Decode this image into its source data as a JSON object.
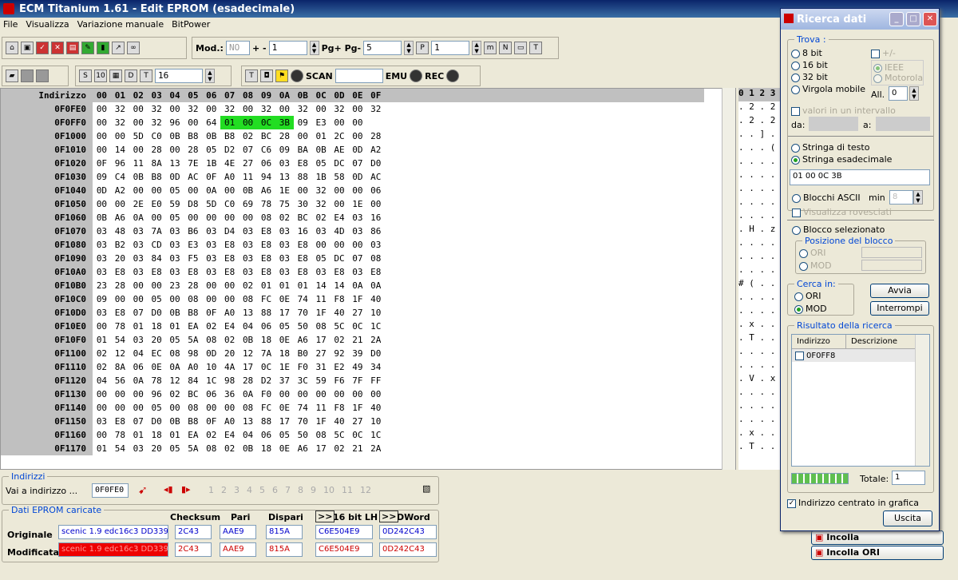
{
  "window": {
    "title": "ECM Titanium 1.61 - Edit EPROM (esadecimale)"
  },
  "menu": [
    "File",
    "Visualizza",
    "Variazione manuale",
    "BitPower"
  ],
  "toolbar": {
    "mod_label": "Mod.:",
    "mod_value": "NO",
    "plus_minus": "+ -",
    "step_value": "1",
    "pg_label": "Pg+ Pg-",
    "pg_value": "5",
    "p_value": "1",
    "width_value": "16",
    "scan_label": "SCAN",
    "emu_label": "EMU",
    "rec_label": "REC"
  },
  "hex": {
    "header_addr": "Indirizzo",
    "columns": [
      "00",
      "01",
      "02",
      "03",
      "04",
      "05",
      "06",
      "07",
      "08",
      "09",
      "0A",
      "0B",
      "0C",
      "0D",
      "0E",
      "0F"
    ],
    "rows": [
      {
        "addr": "0F0FE0",
        "bytes": [
          "00",
          "32",
          "00",
          "32",
          "00",
          "32",
          "00",
          "32",
          "00",
          "32",
          "00",
          "32",
          "00",
          "32",
          "00",
          "32"
        ]
      },
      {
        "addr": "0F0FF0",
        "bytes": [
          "00",
          "32",
          "00",
          "32",
          "96",
          "00",
          "64",
          "01",
          "00",
          "0C",
          "3B",
          "09",
          "E3",
          "00",
          "00"
        ]
      },
      {
        "addr": "0F1000",
        "bytes": [
          "00",
          "00",
          "5D",
          "C0",
          "0B",
          "B8",
          "0B",
          "B8",
          "02",
          "BC",
          "28",
          "00",
          "01",
          "2C",
          "00",
          "28"
        ]
      },
      {
        "addr": "0F1010",
        "bytes": [
          "00",
          "14",
          "00",
          "28",
          "00",
          "28",
          "05",
          "D2",
          "07",
          "C6",
          "09",
          "BA",
          "0B",
          "AE",
          "0D",
          "A2"
        ]
      },
      {
        "addr": "0F1020",
        "bytes": [
          "0F",
          "96",
          "11",
          "8A",
          "13",
          "7E",
          "1B",
          "4E",
          "27",
          "06",
          "03",
          "E8",
          "05",
          "DC",
          "07",
          "D0"
        ]
      },
      {
        "addr": "0F1030",
        "bytes": [
          "09",
          "C4",
          "0B",
          "B8",
          "0D",
          "AC",
          "0F",
          "A0",
          "11",
          "94",
          "13",
          "88",
          "1B",
          "58",
          "0D",
          "AC"
        ]
      },
      {
        "addr": "0F1040",
        "bytes": [
          "0D",
          "A2",
          "00",
          "00",
          "05",
          "00",
          "0A",
          "00",
          "0B",
          "A6",
          "1E",
          "00",
          "32",
          "00",
          "00",
          "06"
        ]
      },
      {
        "addr": "0F1050",
        "bytes": [
          "00",
          "00",
          "2E",
          "E0",
          "59",
          "D8",
          "5D",
          "C0",
          "69",
          "78",
          "75",
          "30",
          "32",
          "00",
          "1E",
          "00"
        ]
      },
      {
        "addr": "0F1060",
        "bytes": [
          "0B",
          "A6",
          "0A",
          "00",
          "05",
          "00",
          "00",
          "00",
          "00",
          "08",
          "02",
          "BC",
          "02",
          "E4",
          "03",
          "16"
        ]
      },
      {
        "addr": "0F1070",
        "bytes": [
          "03",
          "48",
          "03",
          "7A",
          "03",
          "B6",
          "03",
          "D4",
          "03",
          "E8",
          "03",
          "16",
          "03",
          "4D",
          "03",
          "86"
        ]
      },
      {
        "addr": "0F1080",
        "bytes": [
          "03",
          "B2",
          "03",
          "CD",
          "03",
          "E3",
          "03",
          "E8",
          "03",
          "E8",
          "03",
          "E8",
          "00",
          "00",
          "00",
          "03"
        ]
      },
      {
        "addr": "0F1090",
        "bytes": [
          "03",
          "20",
          "03",
          "84",
          "03",
          "F5",
          "03",
          "E8",
          "03",
          "E8",
          "03",
          "E8",
          "05",
          "DC",
          "07",
          "08"
        ]
      },
      {
        "addr": "0F10A0",
        "bytes": [
          "03",
          "E8",
          "03",
          "E8",
          "03",
          "E8",
          "03",
          "E8",
          "03",
          "E8",
          "03",
          "E8",
          "03",
          "E8",
          "03",
          "E8"
        ]
      },
      {
        "addr": "0F10B0",
        "bytes": [
          "23",
          "28",
          "00",
          "00",
          "23",
          "28",
          "00",
          "00",
          "02",
          "01",
          "01",
          "01",
          "14",
          "14",
          "0A",
          "0A"
        ]
      },
      {
        "addr": "0F10C0",
        "bytes": [
          "09",
          "00",
          "00",
          "05",
          "00",
          "08",
          "00",
          "00",
          "08",
          "FC",
          "0E",
          "74",
          "11",
          "F8",
          "1F",
          "40"
        ]
      },
      {
        "addr": "0F10D0",
        "bytes": [
          "03",
          "E8",
          "07",
          "D0",
          "0B",
          "B8",
          "0F",
          "A0",
          "13",
          "88",
          "17",
          "70",
          "1F",
          "40",
          "27",
          "10"
        ]
      },
      {
        "addr": "0F10E0",
        "bytes": [
          "00",
          "78",
          "01",
          "18",
          "01",
          "EA",
          "02",
          "E4",
          "04",
          "06",
          "05",
          "50",
          "08",
          "5C",
          "0C",
          "1C"
        ]
      },
      {
        "addr": "0F10F0",
        "bytes": [
          "01",
          "54",
          "03",
          "20",
          "05",
          "5A",
          "08",
          "02",
          "0B",
          "18",
          "0E",
          "A6",
          "17",
          "02",
          "21",
          "2A"
        ]
      },
      {
        "addr": "0F1100",
        "bytes": [
          "02",
          "12",
          "04",
          "EC",
          "08",
          "98",
          "0D",
          "20",
          "12",
          "7A",
          "18",
          "B0",
          "27",
          "92",
          "39",
          "D0"
        ]
      },
      {
        "addr": "0F1110",
        "bytes": [
          "02",
          "8A",
          "06",
          "0E",
          "0A",
          "A0",
          "10",
          "4A",
          "17",
          "0C",
          "1E",
          "F0",
          "31",
          "E2",
          "49",
          "34"
        ]
      },
      {
        "addr": "0F1120",
        "bytes": [
          "04",
          "56",
          "0A",
          "78",
          "12",
          "84",
          "1C",
          "98",
          "28",
          "D2",
          "37",
          "3C",
          "59",
          "F6",
          "7F",
          "FF"
        ]
      },
      {
        "addr": "0F1130",
        "bytes": [
          "00",
          "00",
          "00",
          "96",
          "02",
          "BC",
          "06",
          "36",
          "0A",
          "F0",
          "00",
          "00",
          "00",
          "00",
          "00",
          "00"
        ]
      },
      {
        "addr": "0F1140",
        "bytes": [
          "00",
          "00",
          "00",
          "05",
          "00",
          "08",
          "00",
          "00",
          "08",
          "FC",
          "0E",
          "74",
          "11",
          "F8",
          "1F",
          "40"
        ]
      },
      {
        "addr": "0F1150",
        "bytes": [
          "03",
          "E8",
          "07",
          "D0",
          "0B",
          "B8",
          "0F",
          "A0",
          "13",
          "88",
          "17",
          "70",
          "1F",
          "40",
          "27",
          "10"
        ]
      },
      {
        "addr": "0F1160",
        "bytes": [
          "00",
          "78",
          "01",
          "18",
          "01",
          "EA",
          "02",
          "E4",
          "04",
          "06",
          "05",
          "50",
          "08",
          "5C",
          "0C",
          "1C"
        ]
      },
      {
        "addr": "0F1170",
        "bytes": [
          "01",
          "54",
          "03",
          "20",
          "05",
          "5A",
          "08",
          "02",
          "0B",
          "18",
          "0E",
          "A6",
          "17",
          "02",
          "21",
          "2A"
        ]
      }
    ],
    "highlight_row": 1,
    "highlight_cols": [
      7,
      8,
      9,
      10
    ]
  },
  "ascii": {
    "header": "0 1 2 3",
    "rows": [
      ". 2 . 2",
      ". 2 . 2",
      ". . ] .",
      ". . . (",
      ". . . .",
      ". . . .",
      ". . . .",
      ". . . .",
      ". . . .",
      ". H . z",
      ". . . .",
      ". . . .",
      ". . . .",
      "# ( . .",
      ". . . .",
      ". . . .",
      ". x . .",
      ". T . .",
      ". . . .",
      ". . . .",
      ". V . x",
      ". . . .",
      ". . . .",
      ". . . .",
      ". x . .",
      ". T . ."
    ]
  },
  "indirizzi": {
    "title": "Indirizzi",
    "goto_label": "Vai a indirizzo ...",
    "goto_value": "0F0FE0",
    "pages": [
      "1",
      "2",
      "3",
      "4",
      "5",
      "6",
      "7",
      "8",
      "9",
      "10",
      "11",
      "12"
    ]
  },
  "dati": {
    "title": "Dati EPROM caricate",
    "headers": [
      "Checksum",
      "Pari",
      "Dispari",
      "16 bit LH",
      "DWord"
    ],
    "arrow": ">>",
    "rows": [
      {
        "label": "Originale",
        "file": "scenic 1.9 edc16c3 DD3395",
        "checksum": "2C43",
        "pari": "AAE9",
        "dispari": "815A",
        "lh": "C6E504E9",
        "dword": "0D242C43"
      },
      {
        "label": "Modificata",
        "file": "scenic 1.9 edc16c3 DD3395",
        "checksum": "2C43",
        "pari": "AAE9",
        "dispari": "815A",
        "lh": "C6E504E9",
        "dword": "0D242C43"
      }
    ]
  },
  "paste": {
    "incolla": "Incolla",
    "incolla_ori": "Incolla ORI"
  },
  "dialog": {
    "title": "Ricerca dati",
    "trova": "Trova :",
    "bit8": "8 bit",
    "bit16": "16 bit",
    "bit32": "32 bit",
    "virgola": "Virgola mobile",
    "plusminus": "+/-",
    "ieee": "IEEE",
    "motorola": "Motorola",
    "all_label": "All.",
    "all_value": "0",
    "intervallo": "valori in un intervallo",
    "da": "da:",
    "a": "a:",
    "stringa_testo": "Stringa di testo",
    "stringa_esa": "Stringa esadecimale",
    "search_value": "01 00 0C 3B",
    "blocchi": "Blocchi ASCII",
    "min_label": "min",
    "min_value": "8",
    "rovesciati": "Visualizza rovesciati",
    "blocco_sel": "Blocco selezionato",
    "posizione": "Posizione del blocco",
    "ori": "ORI",
    "mod": "MOD",
    "cerca_in": "Cerca in:",
    "avvia": "Avvia",
    "interrompi": "Interrompi",
    "risultato": "Risultato della ricerca",
    "col_indirizzo": "Indirizzo",
    "col_descrizione": "Descrizione",
    "result": "0F0FF8",
    "totale_label": "Totale:",
    "totale_value": "1",
    "centrato": "Indirizzo centrato in grafica",
    "uscita": "Uscita"
  }
}
